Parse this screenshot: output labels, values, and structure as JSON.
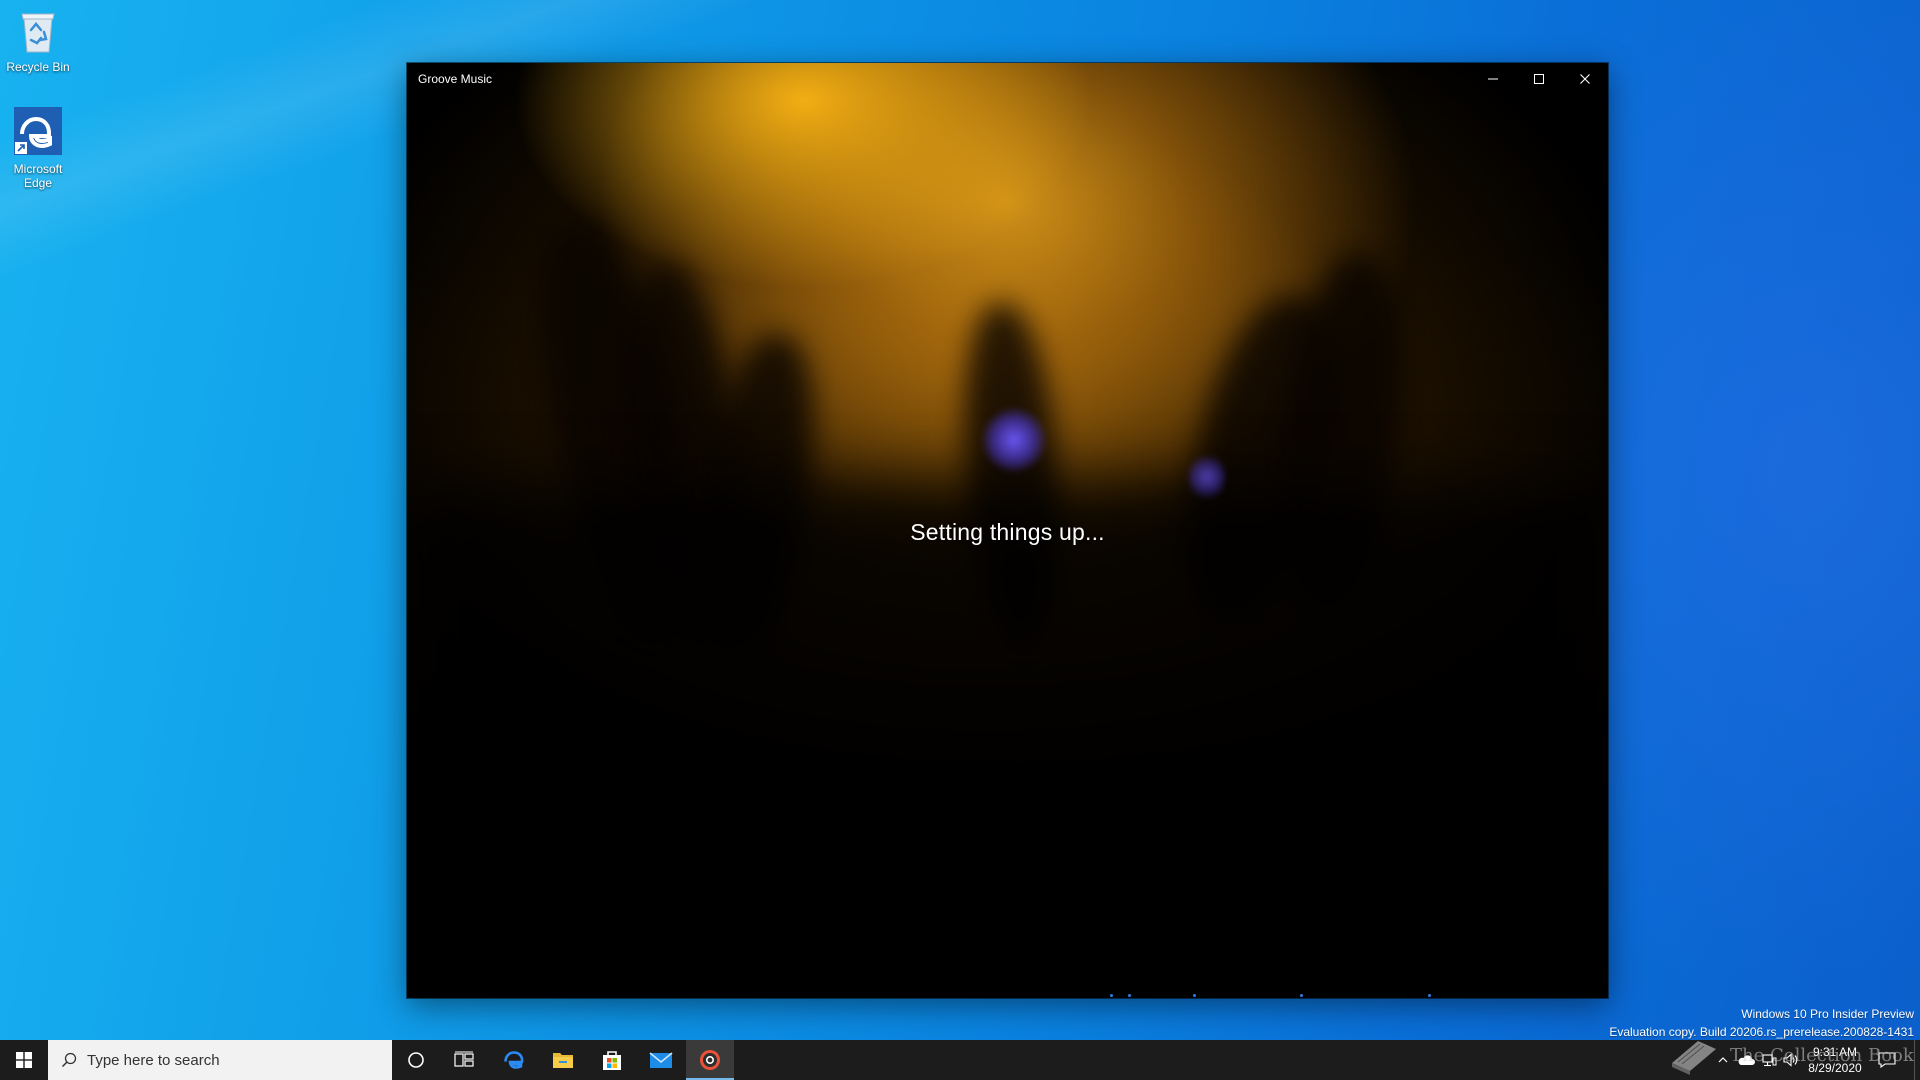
{
  "desktop": {
    "icons": [
      {
        "label": "Recycle Bin",
        "icon": "recycle-bin-icon"
      },
      {
        "label": "Microsoft Edge",
        "icon": "edge-icon"
      }
    ]
  },
  "window": {
    "title": "Groove Music",
    "status": "Setting things up...",
    "caption_buttons": [
      "minimize-icon",
      "maximize-icon",
      "close-icon"
    ]
  },
  "watermark": {
    "line1": "Windows 10 Pro Insider Preview",
    "line2": "Evaluation copy. Build 20206.rs_prerelease.200828-1431"
  },
  "taskbar": {
    "search_placeholder": "Type here to search",
    "apps": [
      "cortana-icon",
      "task-view-icon",
      "edge-icon",
      "file-explorer-icon",
      "store-icon",
      "mail-icon",
      "groove-music-icon"
    ],
    "active_app": "groove-music-icon",
    "clock": {
      "time": "9:31 AM",
      "date": "8/29/2020"
    }
  },
  "overlay_logo": "The Collection Book",
  "colors": {
    "desktop_blue": "#0a84e0",
    "taskbar": "#1c1c1c",
    "accent": "#76b9ed",
    "progress": "#2b7de8"
  }
}
